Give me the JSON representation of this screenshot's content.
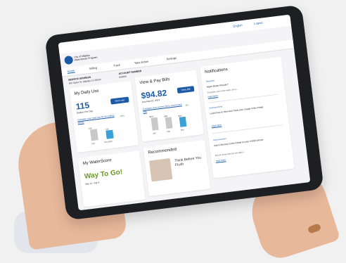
{
  "header": {
    "language": "English",
    "logout": "Logout",
    "logo_line1": "City of Milpitas",
    "logo_line2": "WaterSmart Program"
  },
  "nav": {
    "items": [
      {
        "label": "Home"
      },
      {
        "label": "Billing"
      },
      {
        "label": "Track"
      },
      {
        "label": "Take Action"
      },
      {
        "label": "Settings"
      }
    ]
  },
  "service": {
    "address_label": "SERVICE ADDRESS",
    "address_value": "455 Taylor Dr, Milpitas CA 95035",
    "account_label": "ACCOUNT NUMBER",
    "account_value": "000000"
  },
  "daily_use": {
    "title": "My Daily Use",
    "value": "115",
    "unit": "Gallons Per Day",
    "button": "View use",
    "compare_link": "Compare your past use for this billing period",
    "badge": "-34%",
    "bars": [
      {
        "label": "Oct",
        "sub": "2022",
        "value": "146"
      },
      {
        "label": "Oct 2023",
        "sub": "2023",
        "value": "115"
      }
    ]
  },
  "pay_bills": {
    "title": "View & Pay Bills",
    "amount": "$94.82",
    "due": "Due Mar 22, 2023",
    "button": "View Bill",
    "compare_link": "Compare your current bill to recent past bills",
    "badge": "-8%",
    "bars": [
      {
        "label": "Jan",
        "sub": "2023",
        "value": "$102"
      },
      {
        "label": "Feb",
        "sub": "2023",
        "value": "$99"
      },
      {
        "label": "Mar",
        "sub": "2023",
        "value": "$94"
      }
    ]
  },
  "notifications": {
    "title": "Notifications",
    "items": [
      {
        "tag": "Reminder",
        "headline": "Warm Better Results?",
        "desc": "Complete your home water use p...",
        "link": "read more"
      },
      {
        "tag": "Announcement",
        "headline": "Learn how to View and Track your Usage in the Portal",
        "desc": "",
        "link": "read more"
      },
      {
        "tag": "Announcement",
        "headline": "Add a Shortcut to the Portal on your mobile phone",
        "desc": "Did you know that you can add a ...",
        "link": "read more"
      }
    ]
  },
  "waterscore": {
    "title": "My WaterScore",
    "headline": "Way To Go!",
    "period": "Mar 11 - Apr 9"
  },
  "recommended": {
    "title": "Recommended",
    "item": "Think Before You Flush"
  },
  "colors": {
    "brand": "#1b5aa6",
    "accent_green": "#6a9b1e",
    "nail": "#e33b8d"
  }
}
